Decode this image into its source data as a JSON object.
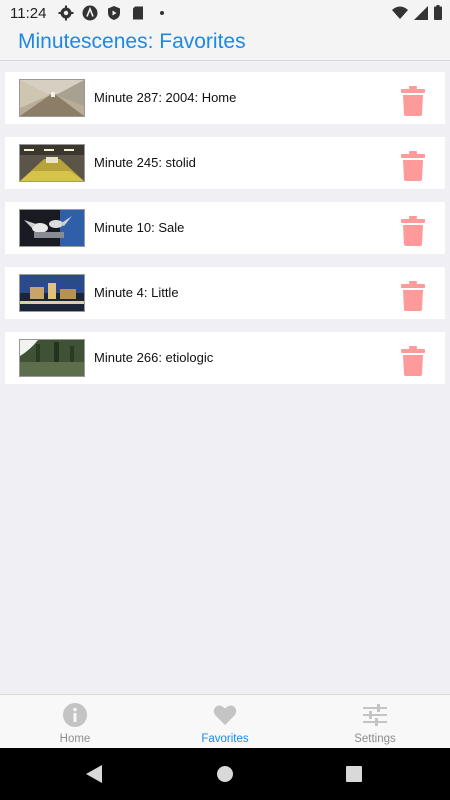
{
  "status": {
    "time": "11:24",
    "icons": [
      "gear-icon",
      "a-circle-icon",
      "shield-play-icon",
      "sd-card-icon",
      "dot-icon",
      "wifi-icon",
      "signal-icon",
      "battery-icon"
    ]
  },
  "header": {
    "title": "Minutescenes: Favorites"
  },
  "favorites": [
    {
      "label": "Minute 287: 2004: Home",
      "thumb": "corridor"
    },
    {
      "label": "Minute 245: stolid",
      "thumb": "subway-platform"
    },
    {
      "label": "Minute 10: Sale",
      "thumb": "birds"
    },
    {
      "label": "Minute 4: Little",
      "thumb": "night-city"
    },
    {
      "label": "Minute 266: etiologic",
      "thumb": "trees"
    }
  ],
  "tabbar": {
    "tabs": [
      {
        "label": "Home",
        "icon": "info-icon",
        "active": false
      },
      {
        "label": "Favorites",
        "icon": "heart-icon",
        "active": true
      },
      {
        "label": "Settings",
        "icon": "sliders-icon",
        "active": false
      }
    ]
  },
  "colors": {
    "accent": "#1e88e5",
    "delete": "#ff9a9a",
    "inactive": "#c4c4c4"
  }
}
